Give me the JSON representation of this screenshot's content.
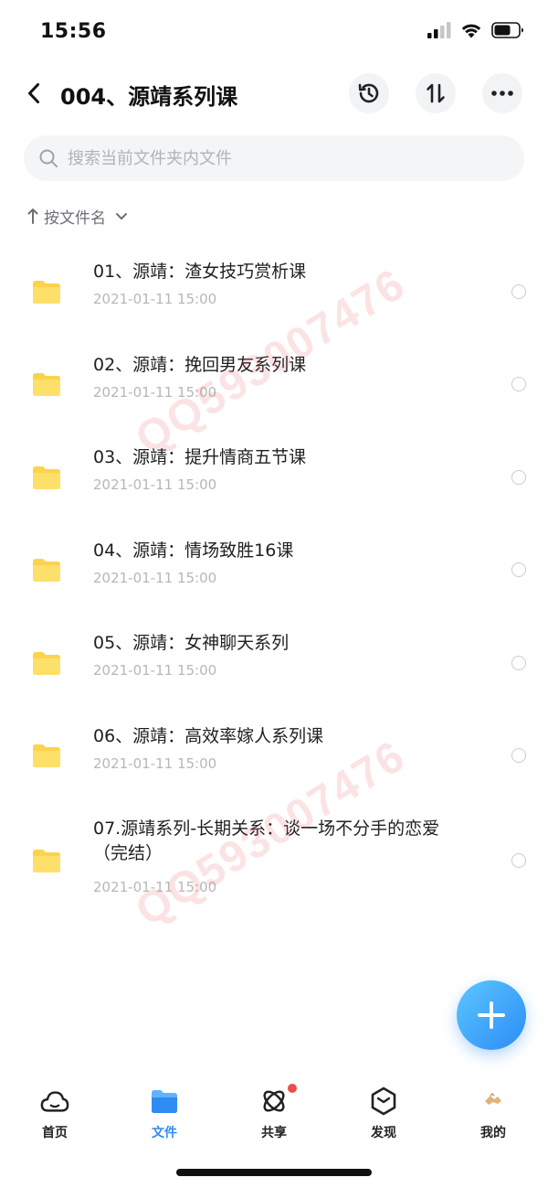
{
  "status_bar": {
    "time": "15:56"
  },
  "nav": {
    "title": "004、源靖系列课"
  },
  "search": {
    "placeholder": "搜索当前文件夹内文件"
  },
  "sort": {
    "label": "按文件名"
  },
  "files": [
    {
      "name": "01、源靖：渣女技巧赏析课",
      "date": "2021-01-11 15:00"
    },
    {
      "name": "02、源靖：挽回男友系列课",
      "date": "2021-01-11 15:00"
    },
    {
      "name": "03、源靖：提升情商五节课",
      "date": "2021-01-11 15:00"
    },
    {
      "name": "04、源靖：情场致胜16课",
      "date": "2021-01-11 15:00"
    },
    {
      "name": "05、源靖：女神聊天系列",
      "date": "2021-01-11 15:00"
    },
    {
      "name": "06、源靖：高效率嫁人系列课",
      "date": "2021-01-11 15:00"
    },
    {
      "name": "07.源靖系列-长期关系：谈一场不分手的恋爱（完结）",
      "date": "2021-01-11 15:00"
    }
  ],
  "watermarks": [
    "QQ593007476",
    "QQ593007476"
  ],
  "tabs": [
    {
      "label": "首页",
      "icon": "cloud-icon"
    },
    {
      "label": "文件",
      "icon": "folder-icon",
      "active": true
    },
    {
      "label": "共享",
      "icon": "atom-icon",
      "badge": true
    },
    {
      "label": "发现",
      "icon": "hexagon-icon"
    },
    {
      "label": "我的",
      "icon": "avatar-icon"
    }
  ],
  "colors": {
    "accent": "#2f8cf3",
    "folder": "#fcd34d",
    "badge": "#f04b4b"
  }
}
